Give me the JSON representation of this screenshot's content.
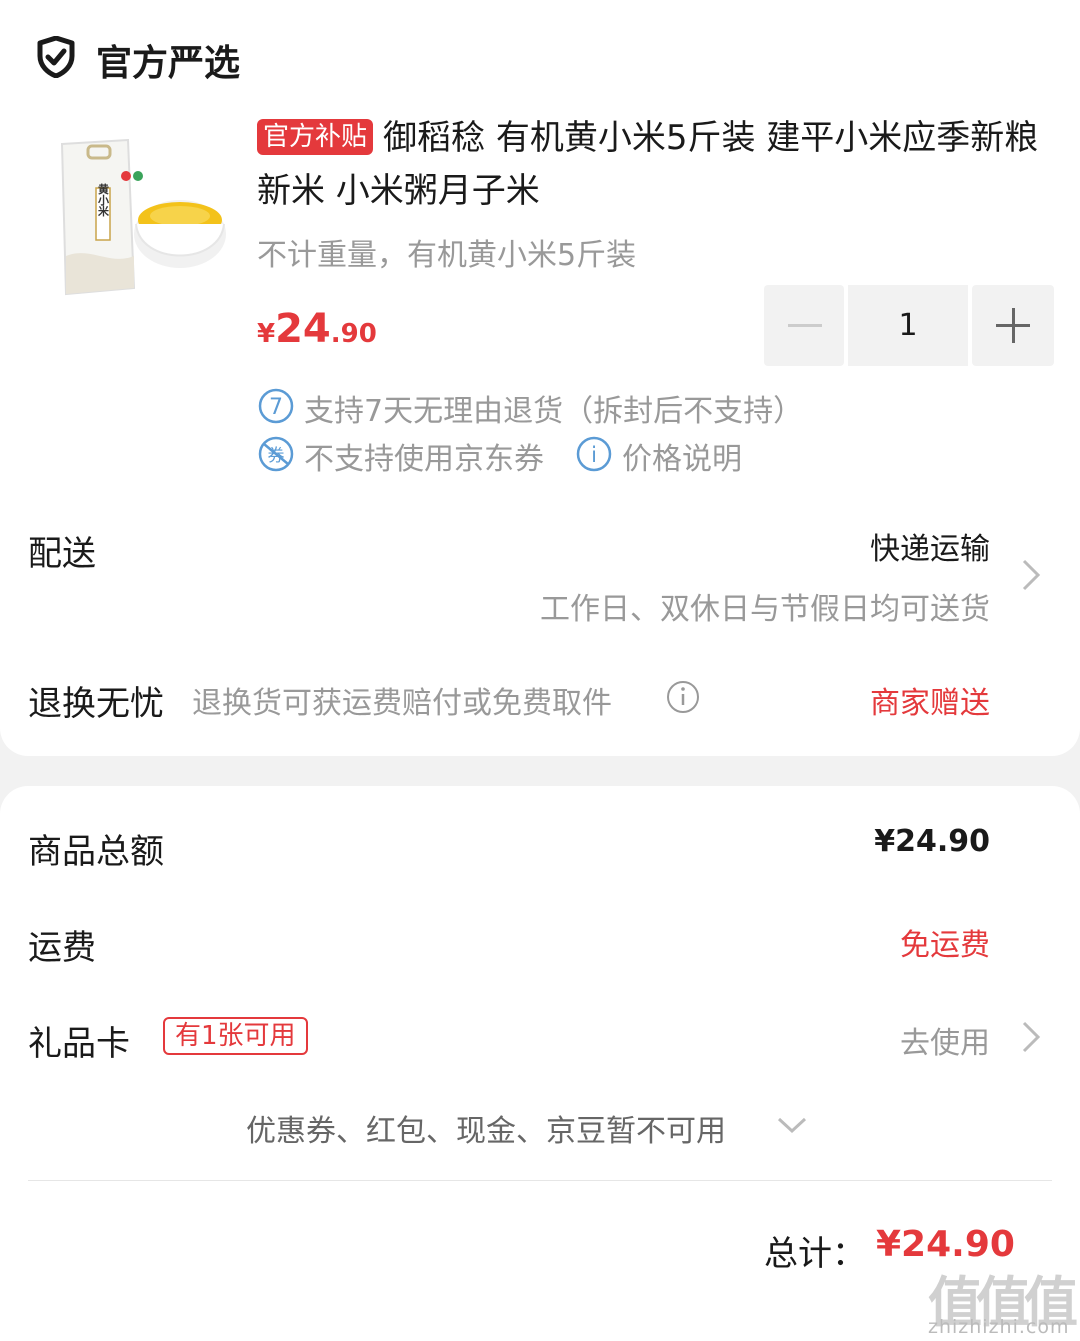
{
  "store": {
    "name": "官方严选",
    "icon": "shield-check-icon"
  },
  "product": {
    "badge": "官方补贴",
    "title": "御稻稔 有机黄小米5斤装 建平小米应季新粮新米 小米粥月子米",
    "spec": "不计重量，有机黄小米5斤装",
    "price_symbol": "¥",
    "price_int": "24",
    "price_dec": ".90",
    "quantity": "1",
    "package_text": "黄小米"
  },
  "services": [
    {
      "icon": "seven-day-return-icon",
      "icon_text": "7",
      "text": "支持7天无理由退货（拆封后不支持）"
    },
    {
      "icon": "no-coupon-icon",
      "icon_text": "券",
      "text": "不支持使用京东券"
    },
    {
      "icon": "info-icon",
      "icon_text": "i",
      "text": "价格说明"
    }
  ],
  "delivery": {
    "label": "配送",
    "method": "快递运输",
    "note": "工作日、双休日与节假日均可送货"
  },
  "returns": {
    "label": "退换无忧",
    "desc": "退换货可获运费赔付或免费取件",
    "value": "商家赠送"
  },
  "summary": {
    "goods_label": "商品总额",
    "goods_value": "¥24.90",
    "shipping_label": "运费",
    "shipping_value": "免运费",
    "giftcard_label": "礼品卡",
    "giftcard_badge": "有1张可用",
    "giftcard_action": "去使用",
    "unavailable_note": "优惠券、红包、现金、京豆暂不可用"
  },
  "total": {
    "label": "总计：",
    "value": "¥24.90"
  },
  "watermark": {
    "glyphs": "值值值",
    "domain": "zhizhizhi.com"
  },
  "colors": {
    "accent_red": "#e4393c",
    "muted": "#999999",
    "info_blue": "#5b9bd5"
  }
}
